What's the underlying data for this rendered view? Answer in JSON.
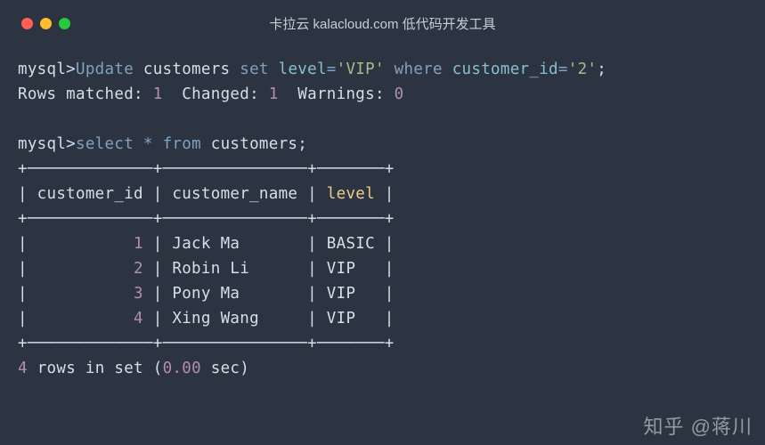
{
  "window": {
    "title": "卡拉云 kalacloud.com 低代码开发工具"
  },
  "terminal": {
    "prompt": "mysql>",
    "line1": {
      "kw_update": "Update",
      "table": "customers",
      "kw_set": "set",
      "col_level": "level",
      "eq1": "=",
      "val_vip": "'VIP'",
      "kw_where": "where",
      "col_cid": "customer_id",
      "eq2": "=",
      "val_2": "'2'",
      "semi": ";"
    },
    "line2": {
      "rows_matched_lbl": "Rows matched:",
      "rows_matched_val": "1",
      "changed_lbl": "Changed:",
      "changed_val": "1",
      "warnings_lbl": "Warnings:",
      "warnings_val": "0"
    },
    "line3": {
      "kw_select": "select",
      "star": "*",
      "kw_from": "from",
      "table": "customers",
      "semi": ";"
    },
    "table": {
      "border_top": "+─────────────+───────────────+───────+",
      "header": "| customer_id | customer_name | level |",
      "border_mid": "+─────────────+───────────────+───────+",
      "rows": [
        {
          "id": "1",
          "name": "Jack Ma      ",
          "level": "BASIC"
        },
        {
          "id": "2",
          "name": "Robin Li     ",
          "level": "VIP  "
        },
        {
          "id": "3",
          "name": "Pony Ma      ",
          "level": "VIP  "
        },
        {
          "id": "4",
          "name": "Xing Wang    ",
          "level": "VIP  "
        }
      ],
      "border_bot": "+─────────────+───────────────+───────+"
    },
    "footer": {
      "count": "4",
      "rows_in_set": "rows in set",
      "paren_open": "(",
      "time": "0.00",
      "sec": "sec",
      "paren_close": ")"
    }
  },
  "watermark": "知乎 @蒋川"
}
